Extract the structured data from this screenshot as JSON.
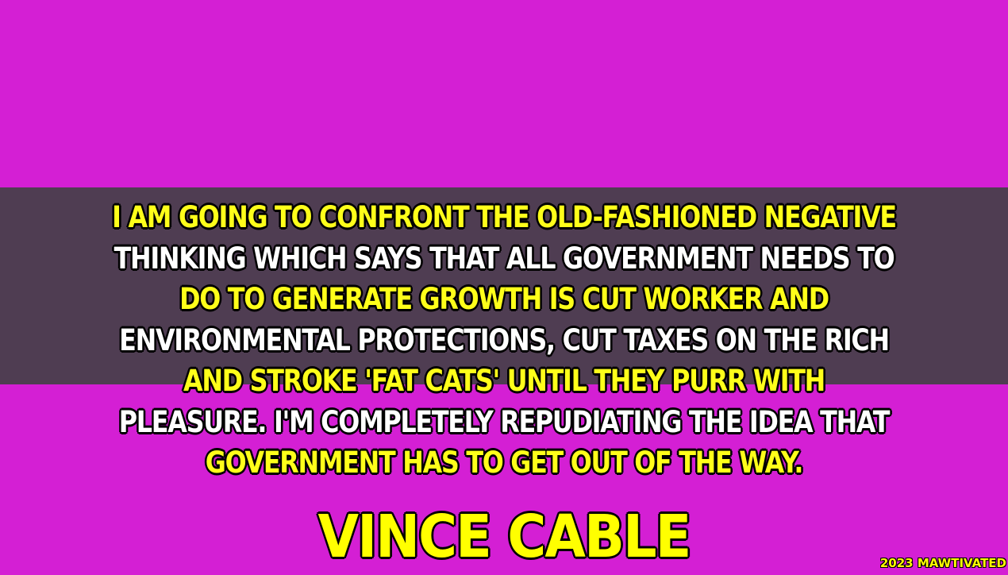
{
  "colors": {
    "background": "#d41fd4",
    "band": "#4f3d52",
    "highlight_text": "#ffff1a",
    "plain_text": "#ffffff",
    "author_text": "#ffff00",
    "outline": "#000000"
  },
  "quote": {
    "lines": [
      {
        "text": "I AM GOING TO CONFRONT THE OLD-FASHIONED NEGATIVE",
        "color": "yellow"
      },
      {
        "text": "THINKING WHICH SAYS THAT ALL GOVERNMENT NEEDS TO",
        "color": "white"
      },
      {
        "text": "DO TO GENERATE GROWTH IS CUT WORKER AND",
        "color": "yellow"
      },
      {
        "text": "ENVIRONMENTAL PROTECTIONS, CUT TAXES ON THE RICH",
        "color": "white"
      },
      {
        "text": "AND STROKE 'FAT CATS' UNTIL THEY PURR WITH",
        "color": "yellow"
      },
      {
        "text": "PLEASURE. I'M COMPLETELY REPUDIATING THE IDEA THAT",
        "color": "white"
      },
      {
        "text": "GOVERNMENT HAS TO GET OUT OF THE WAY.",
        "color": "yellow"
      }
    ]
  },
  "author": {
    "name": "VINCE CABLE"
  },
  "watermark": {
    "text": "2023 MAWTIVATED"
  }
}
